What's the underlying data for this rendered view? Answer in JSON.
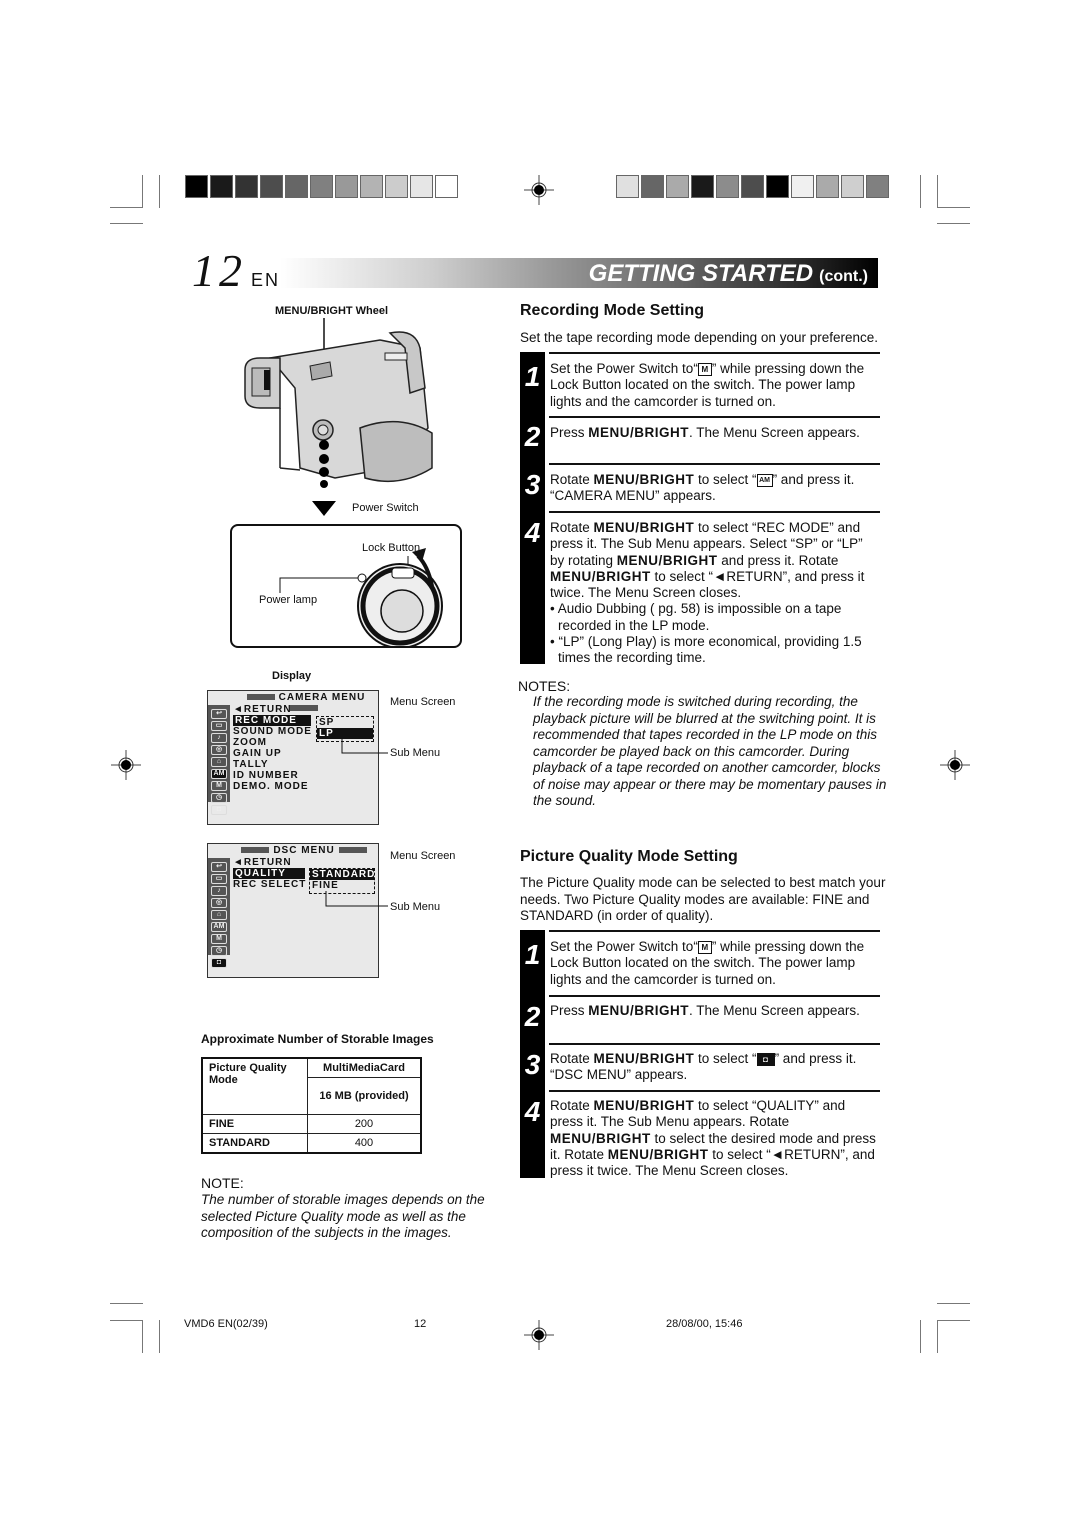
{
  "header": {
    "page_number": "12",
    "language": "EN",
    "section_title": "GETTING STARTED",
    "section_suffix": "(cont.)"
  },
  "colorbars": {
    "left": [
      "#000000",
      "#1a1a1a",
      "#333333",
      "#4d4d4d",
      "#666666",
      "#808080",
      "#999999",
      "#b3b3b3",
      "#cccccc",
      "#e6e6e6",
      "#ffffff"
    ],
    "right": [
      "#e0e0e0",
      "#666666",
      "#aaaaaa",
      "#1a1a1a",
      "#8c8c8c",
      "#4d4d4d",
      "#000000",
      "#f0f0f0",
      "#aaaaaa",
      "#cfcfcf",
      "#808080"
    ]
  },
  "left": {
    "camcorder_label": "MENU/BRIGHT Wheel",
    "power_switch_label": "Power Switch",
    "lock_button_label": "Lock Button",
    "power_lamp_label": "Power lamp",
    "display_label": "Display",
    "camera_menu": {
      "title": "CAMERA MENU",
      "items": [
        "◄RETURN",
        "REC MODE",
        "SOUND MODE",
        "ZOOM",
        "GAIN UP",
        "TALLY",
        "ID NUMBER",
        "DEMO. MODE"
      ],
      "selected_item": "REC MODE",
      "submenu": [
        "SP",
        "LP"
      ],
      "submenu_selected": "LP",
      "menu_screen_label": "Menu Screen",
      "sub_menu_label": "Sub Menu"
    },
    "dsc_menu": {
      "title": "DSC MENU",
      "items": [
        "◄RETURN",
        "QUALITY",
        "REC SELECT"
      ],
      "selected_item": "QUALITY",
      "submenu": [
        "STANDARD",
        "FINE"
      ],
      "submenu_selected": "STANDARD",
      "menu_screen_label": "Menu Screen",
      "sub_menu_label": "Sub Menu"
    },
    "table": {
      "title": "Approximate Number of Storable Images",
      "col1_header": "Picture Quality Mode",
      "col2_header": "MultiMediaCard",
      "col2_sub": "16 MB (provided)",
      "rows": [
        {
          "mode": "FINE",
          "value": "200"
        },
        {
          "mode": "STANDARD",
          "value": "400"
        }
      ]
    },
    "note": {
      "heading": "NOTE:",
      "body": "The number of storable images depends on the selected Picture Quality mode as well as the composition of the subjects in the images."
    }
  },
  "recording": {
    "title": "Recording Mode Setting",
    "intro": "Set the tape recording mode depending on your preference.",
    "steps": [
      {
        "num": "1"
      },
      {
        "num": "2"
      },
      {
        "num": "3"
      },
      {
        "num": "4"
      }
    ],
    "s1": {
      "a": "Set the Power Switch to“",
      "icon": "M",
      "b": "” while pressing down the Lock Button located on the switch. The power lamp lights and the camcorder is turned on."
    },
    "s2": {
      "a": "Press ",
      "bold": "MENU/BRIGHT",
      "b": ". The Menu Screen appears."
    },
    "s3": {
      "a": "Rotate ",
      "bold": "MENU/BRIGHT",
      "b": " to select “",
      "icon": "AM",
      "c": "” and press it. “CAMERA MENU” appears."
    },
    "s4": {
      "a": "Rotate ",
      "bold1": "MENU/BRIGHT",
      "b": " to select “REC MODE” and press it. The Sub Menu appears. Select “SP” or “LP” by rotating ",
      "bold2": "MENU/BRIGHT",
      "c": " and press it. Rotate ",
      "bold3": "MENU/BRIGHT",
      "d": " to select “◄RETURN”, and press it twice. The Menu Screen closes.",
      "bullets": [
        "• Audio Dubbing (   pg. 58) is impossible on a tape recorded in the LP mode.",
        "• “LP” (Long Play) is more economical, providing 1.5 times the recording time."
      ]
    },
    "notes_heading": "NOTES:",
    "notes_body": "If the recording mode is switched during recording, the playback picture will be blurred at the switching point. It is recommended that tapes recorded in the LP mode on this camcorder be played back on this camcorder. During playback of a tape recorded on another camcorder, blocks of noise may appear or there may be momentary pauses in the sound."
  },
  "picture": {
    "title": "Picture Quality Mode Setting",
    "intro": "The Picture Quality mode can be selected to best match your needs. Two Picture Quality modes are available: FINE and STANDARD (in order of quality).",
    "steps": [
      {
        "num": "1"
      },
      {
        "num": "2"
      },
      {
        "num": "3"
      },
      {
        "num": "4"
      }
    ],
    "s1": {
      "a": "Set the Power Switch to“",
      "icon": "M",
      "b": "” while pressing down the Lock Button located on the switch. The power lamp lights and the camcorder is turned on."
    },
    "s2": {
      "a": "Press ",
      "bold": "MENU/BRIGHT",
      "b": ". The Menu Screen appears."
    },
    "s3": {
      "a": "Rotate ",
      "bold": "MENU/BRIGHT",
      "b": " to select “",
      "icon": "◘",
      "c": "” and press it. “DSC MENU” appears."
    },
    "s4": {
      "a": "Rotate ",
      "bold1": "MENU/BRIGHT",
      "b": " to select “QUALITY” and press it. The Sub Menu appears. Rotate ",
      "bold2": "MENU/BRIGHT",
      "c": " to select the desired mode and press it. Rotate ",
      "bold3": "MENU/BRIGHT",
      "d": " to select “◄RETURN”, and press it twice. The Menu Screen closes."
    }
  },
  "footer": {
    "file": "VMD6 EN(02/39)",
    "page": "12",
    "datetime": "28/08/00, 15:46"
  }
}
